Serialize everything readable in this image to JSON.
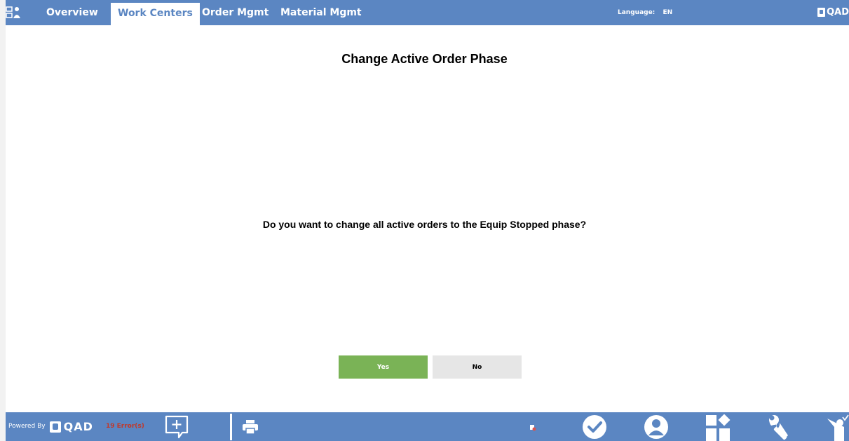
{
  "nav": {
    "tabs": [
      {
        "label": "Overview",
        "active": false
      },
      {
        "label": "Work Centers",
        "active": true
      },
      {
        "label": "Order Mgmt",
        "active": false
      },
      {
        "label": "Material Mgmt",
        "active": false
      }
    ],
    "language_label": "Language:",
    "language_value": "EN",
    "brand": "QAD"
  },
  "dialog": {
    "title": "Change Active Order Phase",
    "question": "Do you want to change all active orders to the Equip Stopped phase?",
    "yes_label": "Yes",
    "no_label": "No"
  },
  "footer": {
    "powered_by": "Powered By",
    "logo_text": "QAD",
    "errors": "19 Error(s)",
    "icons": [
      "add-comment-icon",
      "print-icon",
      "status-dot-icon",
      "checkmark-icon",
      "user-icon",
      "apps-icon",
      "wrench-icon",
      "operator-icon"
    ]
  },
  "colors": {
    "bar": "#5b86c2",
    "yes": "#7ab356",
    "no": "#e6e6e6",
    "error": "#c0392b"
  }
}
